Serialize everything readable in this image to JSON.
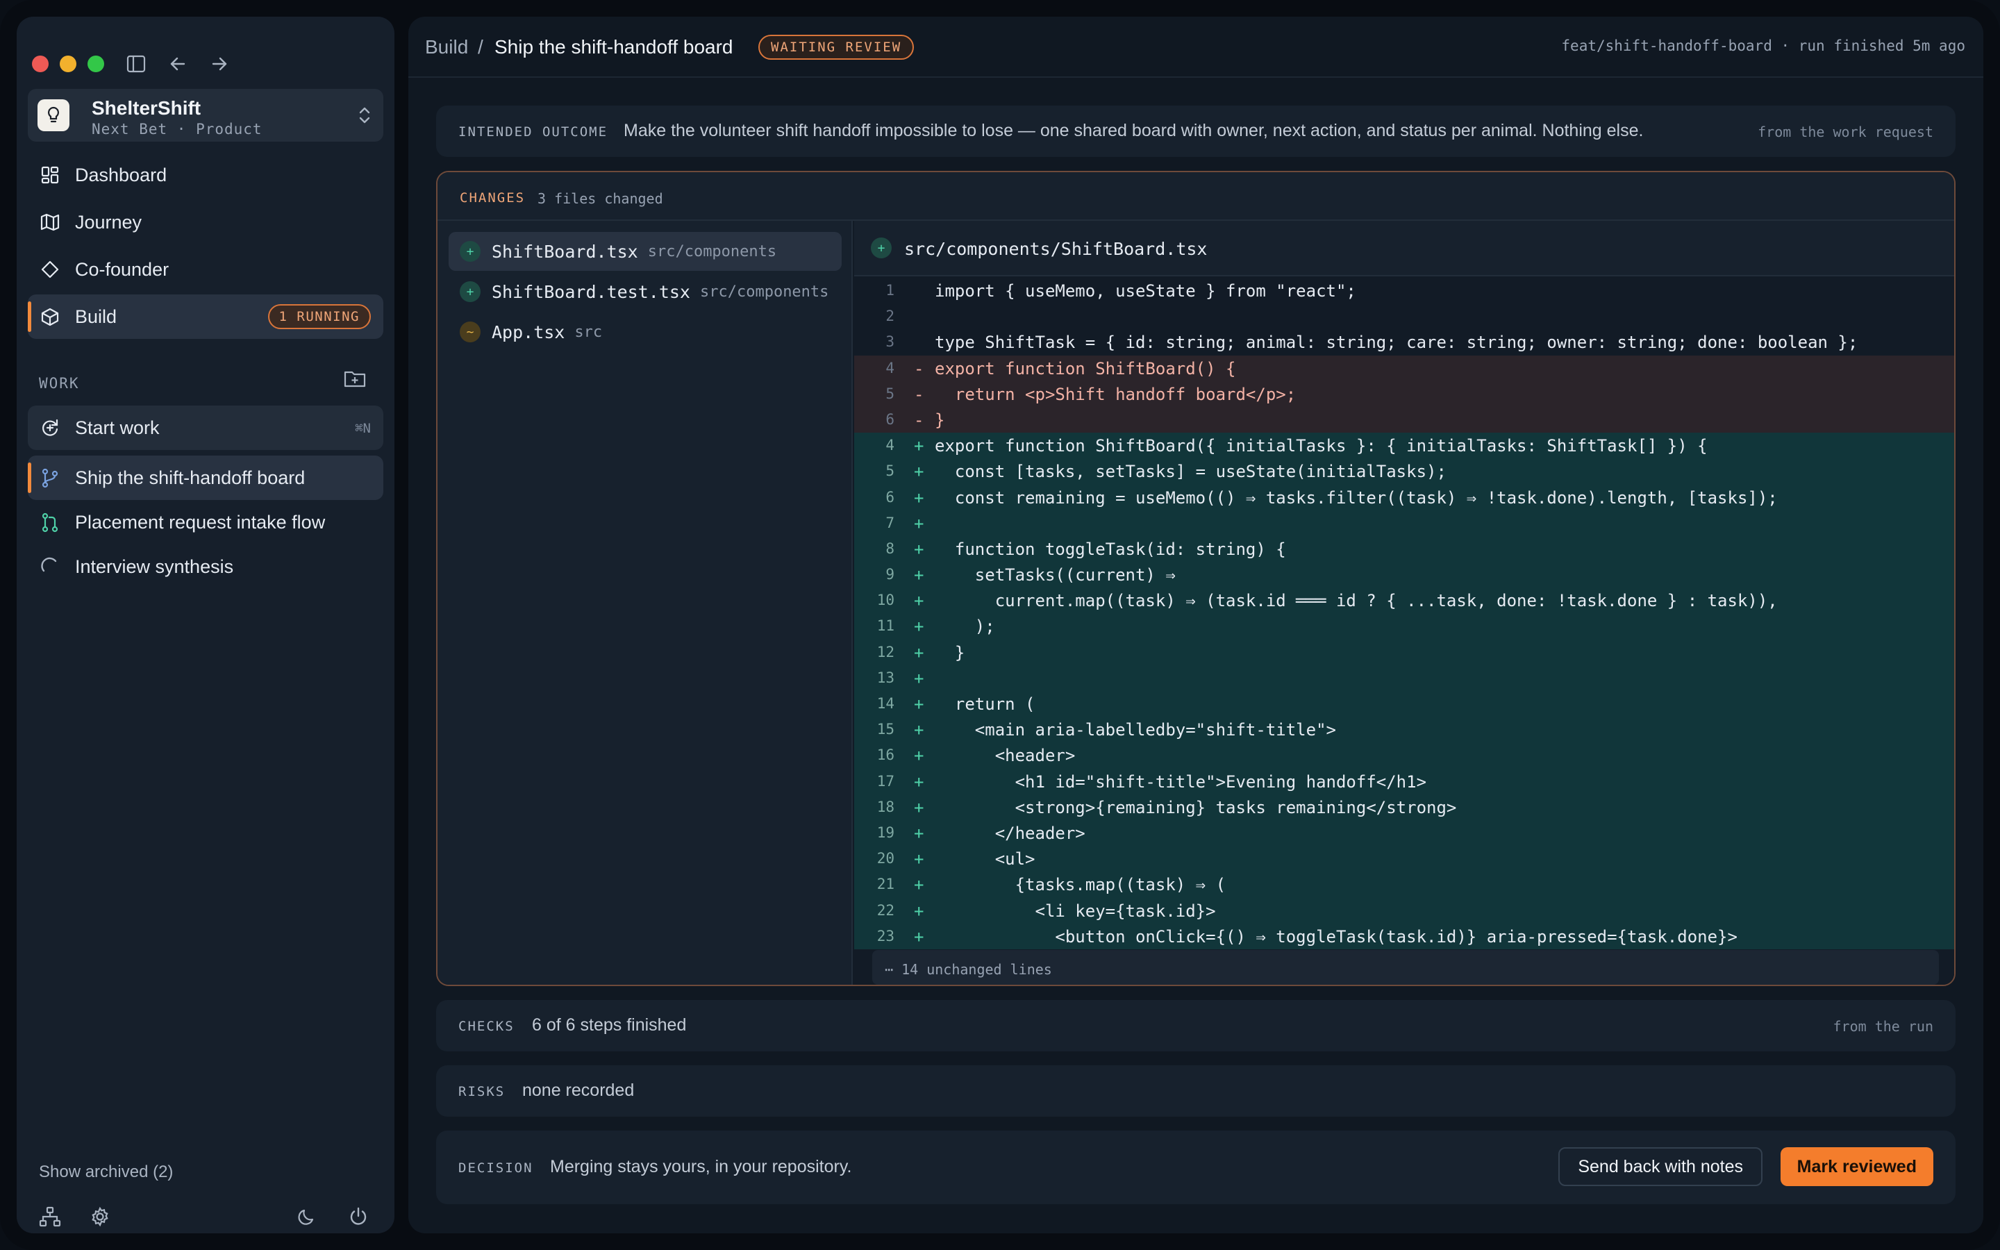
{
  "sidebar": {
    "workspace": {
      "name": "ShelterShift",
      "subtitle": "Next Bet · Product"
    },
    "nav": [
      {
        "label": "Dashboard",
        "icon": "dashboard-icon"
      },
      {
        "label": "Journey",
        "icon": "map-icon"
      },
      {
        "label": "Co-founder",
        "icon": "diamond-icon"
      },
      {
        "label": "Build",
        "icon": "cube-icon",
        "badge": "1 RUNNING",
        "active": true
      }
    ],
    "work_label": "WORK",
    "start_work": {
      "label": "Start work",
      "shortcut": "⌘N"
    },
    "work_items": [
      {
        "label": "Ship the shift-handoff board",
        "icon": "branch-icon",
        "active": true
      },
      {
        "label": "Placement request intake flow",
        "icon": "pull-request-icon"
      },
      {
        "label": "Interview synthesis",
        "icon": "spinner-icon"
      }
    ],
    "show_archived": "Show archived (2)"
  },
  "header": {
    "breadcrumb_root": "Build",
    "separator": "/",
    "title": "Ship the shift-handoff board",
    "status": "WAITING REVIEW",
    "right_text": "feat/shift-handoff-board · run finished 5m ago"
  },
  "outcome": {
    "label": "INTENDED OUTCOME",
    "text": "Make the volunteer shift handoff impossible to lose — one shared board with owner, next action, and status per animal. Nothing else.",
    "note": "from the work request"
  },
  "changes": {
    "label": "CHANGES",
    "count": "3 files changed",
    "files": [
      {
        "name": "ShiftBoard.tsx",
        "path": "src/components",
        "status": "+",
        "active": true
      },
      {
        "name": "ShiftBoard.test.tsx",
        "path": "src/components",
        "status": "+"
      },
      {
        "name": "App.tsx",
        "path": "src",
        "status": "~"
      }
    ],
    "diff_path": "src/components/ShiftBoard.tsx",
    "diff_status": "+",
    "lines": [
      {
        "n": "1",
        "s": "",
        "t": "ctx",
        "c": "import { useMemo, useState } from \"react\";"
      },
      {
        "n": "2",
        "s": "",
        "t": "ctx",
        "c": ""
      },
      {
        "n": "3",
        "s": "",
        "t": "ctx",
        "c": "type ShiftTask = { id: string; animal: string; care: string; owner: string; done: boolean };"
      },
      {
        "n": "4",
        "s": "-",
        "t": "del",
        "c": "export function ShiftBoard() {"
      },
      {
        "n": "5",
        "s": "-",
        "t": "del",
        "c": "  return <p>Shift handoff board</p>;"
      },
      {
        "n": "6",
        "s": "-",
        "t": "del",
        "c": "}"
      },
      {
        "n": "4",
        "s": "+",
        "t": "add",
        "c": "export function ShiftBoard({ initialTasks }: { initialTasks: ShiftTask[] }) {"
      },
      {
        "n": "5",
        "s": "+",
        "t": "add",
        "c": "  const [tasks, setTasks] = useState(initialTasks);"
      },
      {
        "n": "6",
        "s": "+",
        "t": "add",
        "c": "  const remaining = useMemo(() ⇒ tasks.filter((task) ⇒ !task.done).length, [tasks]);"
      },
      {
        "n": "7",
        "s": "+",
        "t": "add",
        "c": ""
      },
      {
        "n": "8",
        "s": "+",
        "t": "add",
        "c": "  function toggleTask(id: string) {"
      },
      {
        "n": "9",
        "s": "+",
        "t": "add",
        "c": "    setTasks((current) ⇒"
      },
      {
        "n": "10",
        "s": "+",
        "t": "add",
        "c": "      current.map((task) ⇒ (task.id ═══ id ? { ...task, done: !task.done } : task)),"
      },
      {
        "n": "11",
        "s": "+",
        "t": "add",
        "c": "    );"
      },
      {
        "n": "12",
        "s": "+",
        "t": "add",
        "c": "  }"
      },
      {
        "n": "13",
        "s": "+",
        "t": "add",
        "c": ""
      },
      {
        "n": "14",
        "s": "+",
        "t": "add",
        "c": "  return ("
      },
      {
        "n": "15",
        "s": "+",
        "t": "add",
        "c": "    <main aria-labelledby=\"shift-title\">"
      },
      {
        "n": "16",
        "s": "+",
        "t": "add",
        "c": "      <header>"
      },
      {
        "n": "17",
        "s": "+",
        "t": "add",
        "c": "        <h1 id=\"shift-title\">Evening handoff</h1>"
      },
      {
        "n": "18",
        "s": "+",
        "t": "add",
        "c": "        <strong>{remaining} tasks remaining</strong>"
      },
      {
        "n": "19",
        "s": "+",
        "t": "add",
        "c": "      </header>"
      },
      {
        "n": "20",
        "s": "+",
        "t": "add",
        "c": "      <ul>"
      },
      {
        "n": "21",
        "s": "+",
        "t": "add",
        "c": "        {tasks.map((task) ⇒ ("
      },
      {
        "n": "22",
        "s": "+",
        "t": "add",
        "c": "          <li key={task.id}>"
      },
      {
        "n": "23",
        "s": "+",
        "t": "add",
        "c": "            <button onClick={() ⇒ toggleTask(task.id)} aria-pressed={task.done}>"
      }
    ],
    "unchanged": "⋯ 14 unchanged lines"
  },
  "checks": {
    "label": "CHECKS",
    "text": "6 of 6 steps finished",
    "note": "from the run"
  },
  "risks": {
    "label": "RISKS",
    "text": "none recorded"
  },
  "decision": {
    "label": "DECISION",
    "text": "Merging stays yours, in your repository.",
    "secondary_button": "Send back with notes",
    "primary_button": "Mark reviewed"
  },
  "colors": {
    "accent": "#f47d2c",
    "added": "#4fd1a8",
    "removed": "#f3b2a5"
  }
}
